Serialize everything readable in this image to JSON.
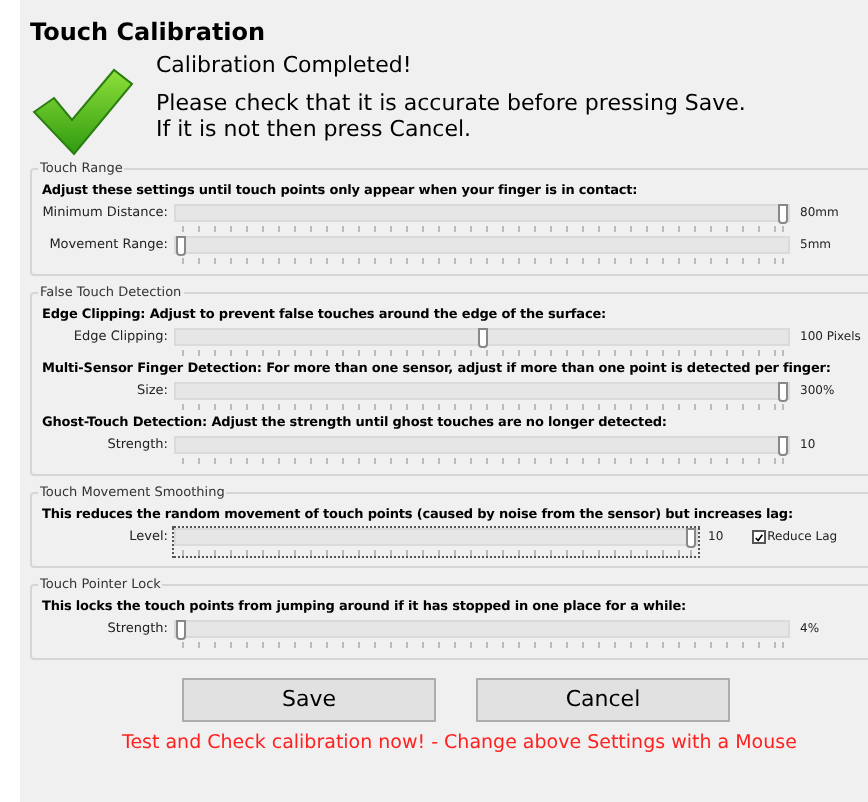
{
  "window": {
    "title": "Touch Calibration"
  },
  "message": {
    "headline": "Calibration Completed!",
    "lines": [
      "Please check that it is accurate before pressing Save.",
      "If it is not then press Cancel."
    ]
  },
  "groups": [
    {
      "title": "Touch Range",
      "items": [
        {
          "kind": "heading",
          "text": "Adjust these settings until touch points only appear when your finger is in contact:"
        },
        {
          "kind": "slider",
          "label": "Minimum Distance:",
          "level": 1,
          "reading": "80mm",
          "focused": false
        },
        {
          "kind": "slider",
          "label": "Movement Range:",
          "level": 0,
          "reading": "5mm",
          "focused": false
        }
      ]
    },
    {
      "title": "False Touch Detection",
      "items": [
        {
          "kind": "heading",
          "text": "Edge Clipping: Adjust to prevent false touches around the edge of the surface:"
        },
        {
          "kind": "slider",
          "label": "Edge Clipping:",
          "level": 0.5,
          "reading": "100 Pixels",
          "focused": false
        },
        {
          "kind": "heading",
          "text": "Multi-Sensor Finger Detection: For more than one sensor, adjust if more than one point is detected per finger:"
        },
        {
          "kind": "slider",
          "label": "Size:",
          "level": 1,
          "reading": "300%",
          "focused": false
        },
        {
          "kind": "heading",
          "text": "Ghost-Touch Detection: Adjust the strength until ghost touches are no longer detected:"
        },
        {
          "kind": "slider",
          "label": "Strength:",
          "level": 1,
          "reading": "10",
          "focused": false
        }
      ]
    },
    {
      "title": "Touch Movement Smoothing",
      "items": [
        {
          "kind": "heading",
          "text": "This reduces the random movement of touch points (caused by noise from the sensor) but increases lag:"
        },
        {
          "kind": "slider",
          "label": "Level:",
          "level": 1,
          "reading": "10",
          "focused": true,
          "checkbox": {
            "label": "Reduce Lag",
            "checked": true
          }
        }
      ]
    },
    {
      "title": "Touch Pointer Lock",
      "items": [
        {
          "kind": "heading",
          "text": "This locks the touch points from jumping around if it has stopped in one place for a while:"
        },
        {
          "kind": "slider",
          "label": "Strength:",
          "level": 0,
          "reading": "4%",
          "focused": false
        }
      ]
    }
  ],
  "buttons": [
    "Save",
    "Cancel"
  ],
  "footer": "Test and Check calibration now! - Change above Settings with a Mouse"
}
